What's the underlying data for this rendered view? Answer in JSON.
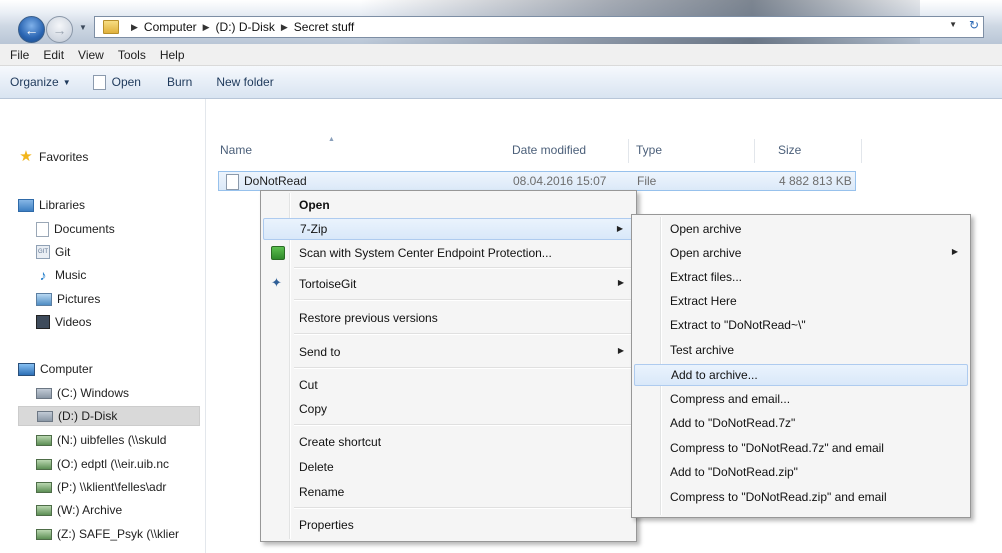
{
  "address": {
    "crumbs": [
      "Computer",
      "(D:) D-Disk",
      "Secret stuff"
    ]
  },
  "menubar": {
    "items": [
      "File",
      "Edit",
      "View",
      "Tools",
      "Help"
    ]
  },
  "commandbar": {
    "organize": "Organize",
    "open": "Open",
    "burn": "Burn",
    "new_folder": "New folder"
  },
  "navpane": {
    "favorites": "Favorites",
    "libraries": "Libraries",
    "library_items": [
      "Documents",
      "Git",
      "Music",
      "Pictures",
      "Videos"
    ],
    "computer": "Computer",
    "drives": [
      "(C:) Windows",
      "(D:) D-Disk",
      "(N:) uibfelles (\\\\skuld",
      "(O:) edptl (\\\\eir.uib.nc",
      "(P:) \\\\klient\\felles\\adr",
      "(W:) Archive",
      "(Z:) SAFE_Psyk (\\\\klier"
    ]
  },
  "filelist": {
    "columns": [
      "Name",
      "Date modified",
      "Type",
      "Size"
    ],
    "file": {
      "name": "DoNotRead",
      "date": "08.04.2016 15:07",
      "type": "File",
      "size": "4 882 813 KB"
    }
  },
  "context_menu": {
    "open": "Open",
    "seven_zip": "7-Zip",
    "scan": "Scan with System Center Endpoint Protection...",
    "tortoisegit": "TortoiseGit",
    "restore": "Restore previous versions",
    "send_to": "Send to",
    "cut": "Cut",
    "copy": "Copy",
    "create_shortcut": "Create shortcut",
    "delete": "Delete",
    "rename": "Rename",
    "properties": "Properties"
  },
  "submenu": {
    "items": [
      "Open archive",
      "Open archive",
      "Extract files...",
      "Extract Here",
      "Extract to \"DoNotRead~\\\"",
      "Test archive",
      "Add to archive...",
      "Compress and email...",
      "Add to \"DoNotRead.7z\"",
      "Compress to \"DoNotRead.7z\" and email",
      "Add to \"DoNotRead.zip\"",
      "Compress to \"DoNotRead.zip\" and email"
    ]
  }
}
